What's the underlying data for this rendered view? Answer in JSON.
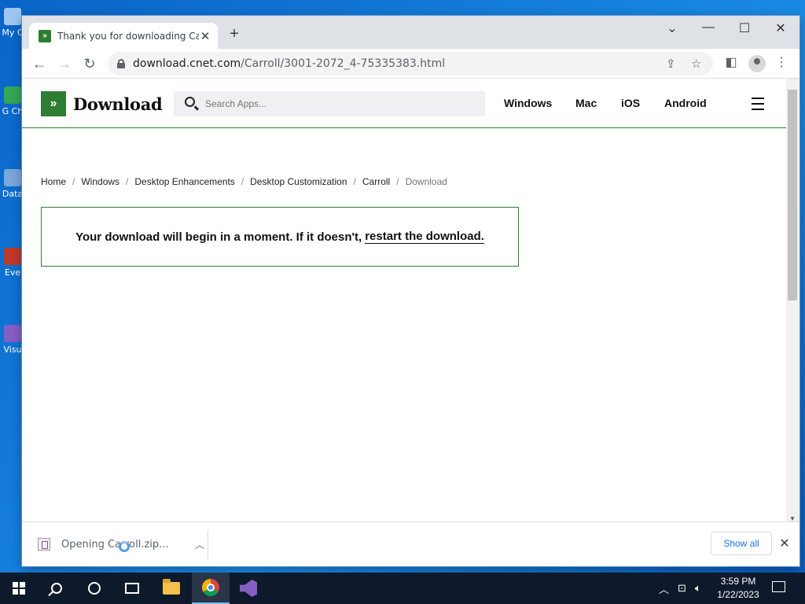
{
  "desktop": {
    "icons": [
      {
        "label": "My C",
        "color": "#9fc6f0"
      },
      {
        "label": "G Ch",
        "color": "#34a853"
      },
      {
        "label": "Data",
        "color": "#7ba7d9"
      },
      {
        "label": "Eve",
        "color": "#c0392b"
      },
      {
        "label": "Visu",
        "color": "#865fc5"
      }
    ]
  },
  "browser": {
    "tab": {
      "title": "Thank you for downloading Carroll",
      "favicon": "download-favicon"
    },
    "url": {
      "host": "download.cnet.com",
      "path": "/Carroll/3001-2072_4-75335383.html"
    }
  },
  "site": {
    "logo_text": "Download",
    "search_placeholder": "Search Apps...",
    "nav": [
      "Windows",
      "Mac",
      "iOS",
      "Android"
    ],
    "accent": "#2e7d32"
  },
  "breadcrumb": [
    "Home",
    "Windows",
    "Desktop Enhancements",
    "Desktop Customization",
    "Carroll",
    "Download"
  ],
  "notice": {
    "text": "Your download will begin in a moment. If it doesn't,",
    "link": "restart the download."
  },
  "download_shelf": {
    "item_label": "Opening Carroll.zip...",
    "show_all": "Show all"
  },
  "taskbar": {
    "time": "3:59 PM",
    "date": "1/22/2023"
  }
}
